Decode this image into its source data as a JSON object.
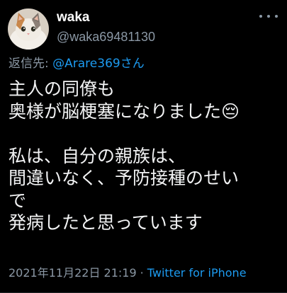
{
  "user": {
    "display_name": "waka",
    "handle": "@waka69481130",
    "avatar": "cat-photo"
  },
  "reply": {
    "prefix": "返信先: ",
    "target": "@Arare369さん"
  },
  "tweet": {
    "text": "主人の同僚も\n奥様が脳梗塞になりました😔\n\n私は、自分の親族は、\n間違いなく、予防接種のせい\nで\n発病したと思っています"
  },
  "footer": {
    "datetime": "2021年11月22日 21:19",
    "separator": "·",
    "source": "Twitter for iPhone"
  },
  "icons": {
    "more": "more-dots-icon"
  },
  "colors": {
    "background": "#000000",
    "link": "#1d9bf0",
    "secondary_text": "#8b98a5"
  }
}
